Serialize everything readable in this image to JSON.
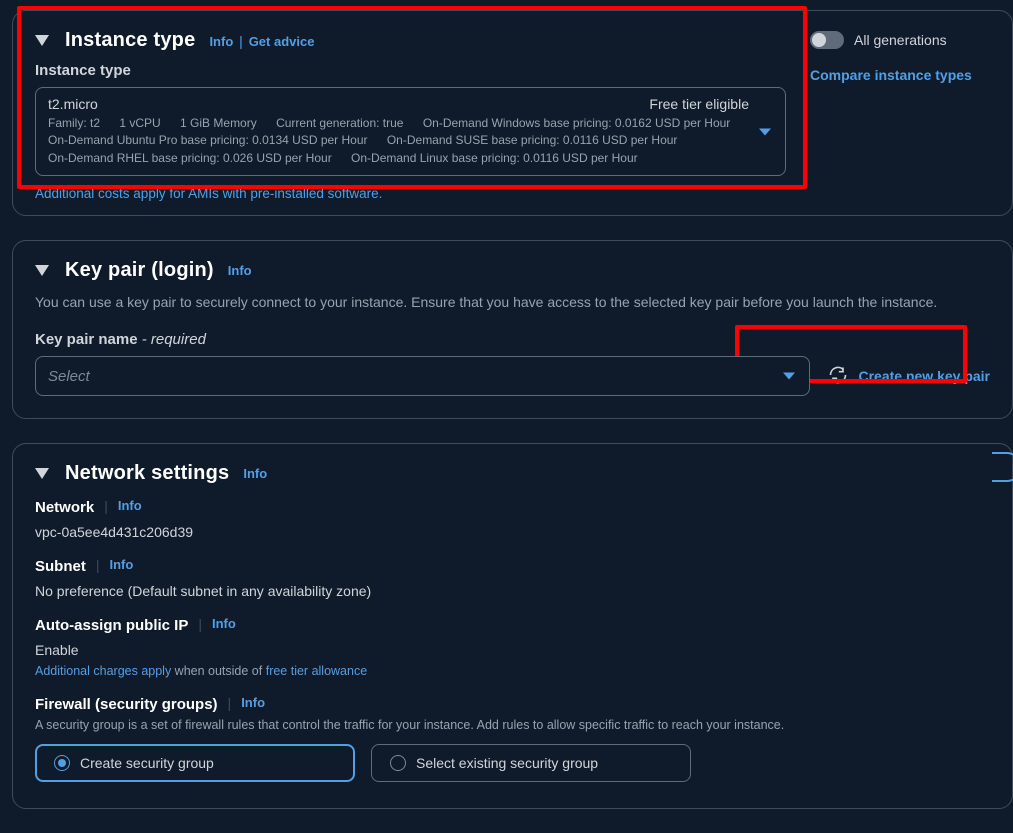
{
  "instance": {
    "section_title": "Instance type",
    "info": "Info",
    "get_advice": "Get advice",
    "field_label": "Instance type",
    "selected": {
      "name": "t2.micro",
      "eligibility": "Free tier eligible",
      "family": "Family: t2",
      "vcpu": "1 vCPU",
      "memory": "1 GiB Memory",
      "current_gen": "Current generation: true",
      "win": "On-Demand Windows base pricing: 0.0162 USD per Hour",
      "ubuntu": "On-Demand Ubuntu Pro base pricing: 0.0134 USD per Hour",
      "suse": "On-Demand SUSE base pricing: 0.0116 USD per Hour",
      "rhel": "On-Demand RHEL base pricing: 0.026 USD per Hour",
      "linux": "On-Demand Linux base pricing: 0.0116 USD per Hour"
    },
    "additional_costs": "Additional costs apply for AMIs with pre-installed software.",
    "all_generations": "All generations",
    "compare": "Compare instance types"
  },
  "keypair": {
    "section_title": "Key pair (login)",
    "info": "Info",
    "description": "You can use a key pair to securely connect to your instance. Ensure that you have access to the selected key pair before you launch the instance.",
    "field_label": "Key pair name",
    "required": " - required",
    "placeholder": "Select",
    "create": "Create new key pair"
  },
  "network": {
    "section_title": "Network settings",
    "info": "Info",
    "network_label": "Network",
    "network_value": "vpc-0a5ee4d431c206d39",
    "subnet_label": "Subnet",
    "subnet_value": "No preference (Default subnet in any availability zone)",
    "autoip_label": "Auto-assign public IP",
    "autoip_value": "Enable",
    "charges_pre": "Additional charges apply",
    "charges_mid": " when outside of ",
    "charges_link": "free tier allowance",
    "firewall_label": "Firewall (security groups)",
    "firewall_desc": "A security group is a set of firewall rules that control the traffic for your instance. Add rules to allow specific traffic to reach your instance.",
    "radio_create": "Create security group",
    "radio_select": "Select existing security group"
  }
}
